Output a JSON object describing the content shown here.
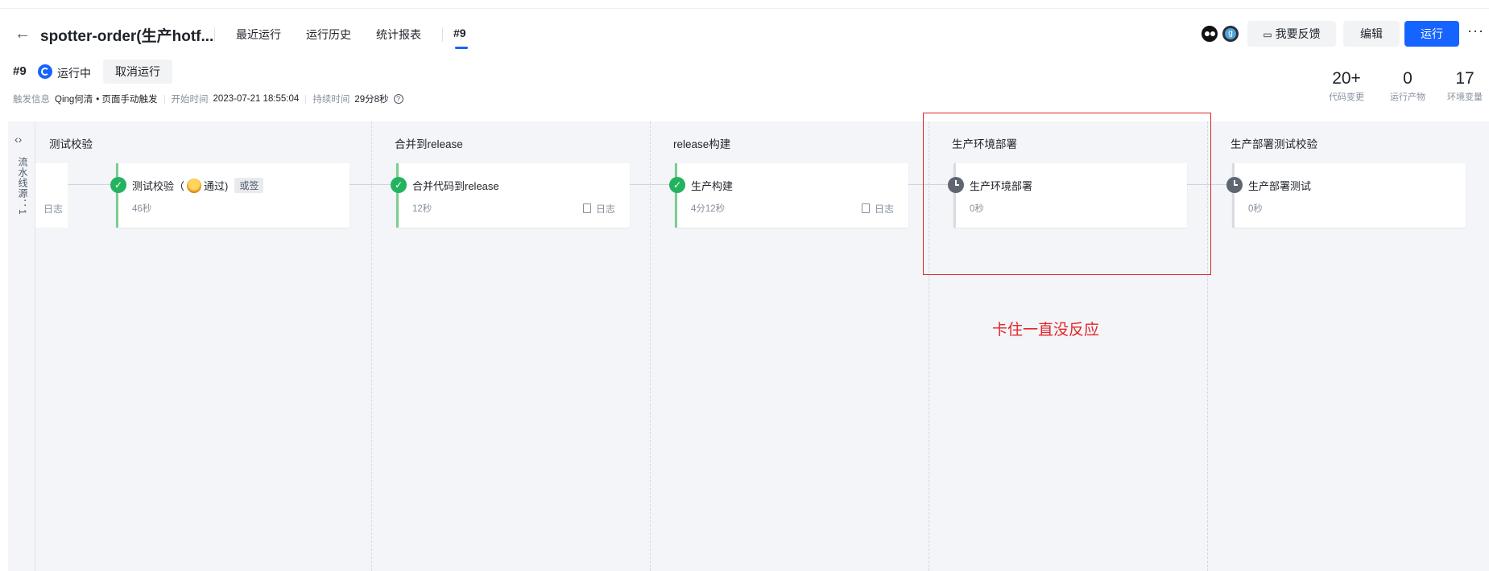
{
  "header": {
    "title": "spotter-order(生产hotf...",
    "tabs": [
      "最近运行",
      "运行历史",
      "统计报表",
      "#9"
    ],
    "feedback_label": "我要反馈",
    "edit_label": "编辑",
    "run_label": "运行",
    "avatar_letter": "g"
  },
  "run": {
    "number": "#9",
    "status": "运行中",
    "cancel_label": "取消运行",
    "trigger_label": "触发信息",
    "trigger_user": "Qing何清",
    "trigger_source": "• 页面手动触发",
    "start_label": "开始时间",
    "start_time": "2023-07-21 18:55:04",
    "duration_label": "持续时间",
    "duration": "29分8秒"
  },
  "stats": [
    {
      "value": "20+",
      "label": "代码变更"
    },
    {
      "value": "0",
      "label": "运行产物"
    },
    {
      "value": "17",
      "label": "环境变量"
    }
  ],
  "sidebar": {
    "label": "流水线源：1"
  },
  "partial_card_log": "日志",
  "stages": [
    {
      "title": "测试校验",
      "job": {
        "name": "测试校验（",
        "approver_suffix": "通过)",
        "tag": "或签",
        "duration": "46秒",
        "status": "success"
      }
    },
    {
      "title": "合并到release",
      "job": {
        "name": "合并代码到release",
        "duration": "12秒",
        "log": "日志",
        "status": "success"
      }
    },
    {
      "title": "release构建",
      "job": {
        "name": "生产构建",
        "duration": "4分12秒",
        "log": "日志",
        "status": "success"
      }
    },
    {
      "title": "生产环境部署",
      "job": {
        "name": "生产环境部署",
        "duration": "0秒",
        "status": "waiting"
      }
    },
    {
      "title": "生产部署测试校验",
      "job": {
        "name": "生产部署测试",
        "duration": "0秒",
        "status": "waiting"
      }
    }
  ],
  "annotation": {
    "text": "卡住一直没反应",
    "color": "#e0262b"
  },
  "colors": {
    "accent": "#1664ff",
    "success": "#23b35f",
    "waiting": "#5f6670"
  }
}
